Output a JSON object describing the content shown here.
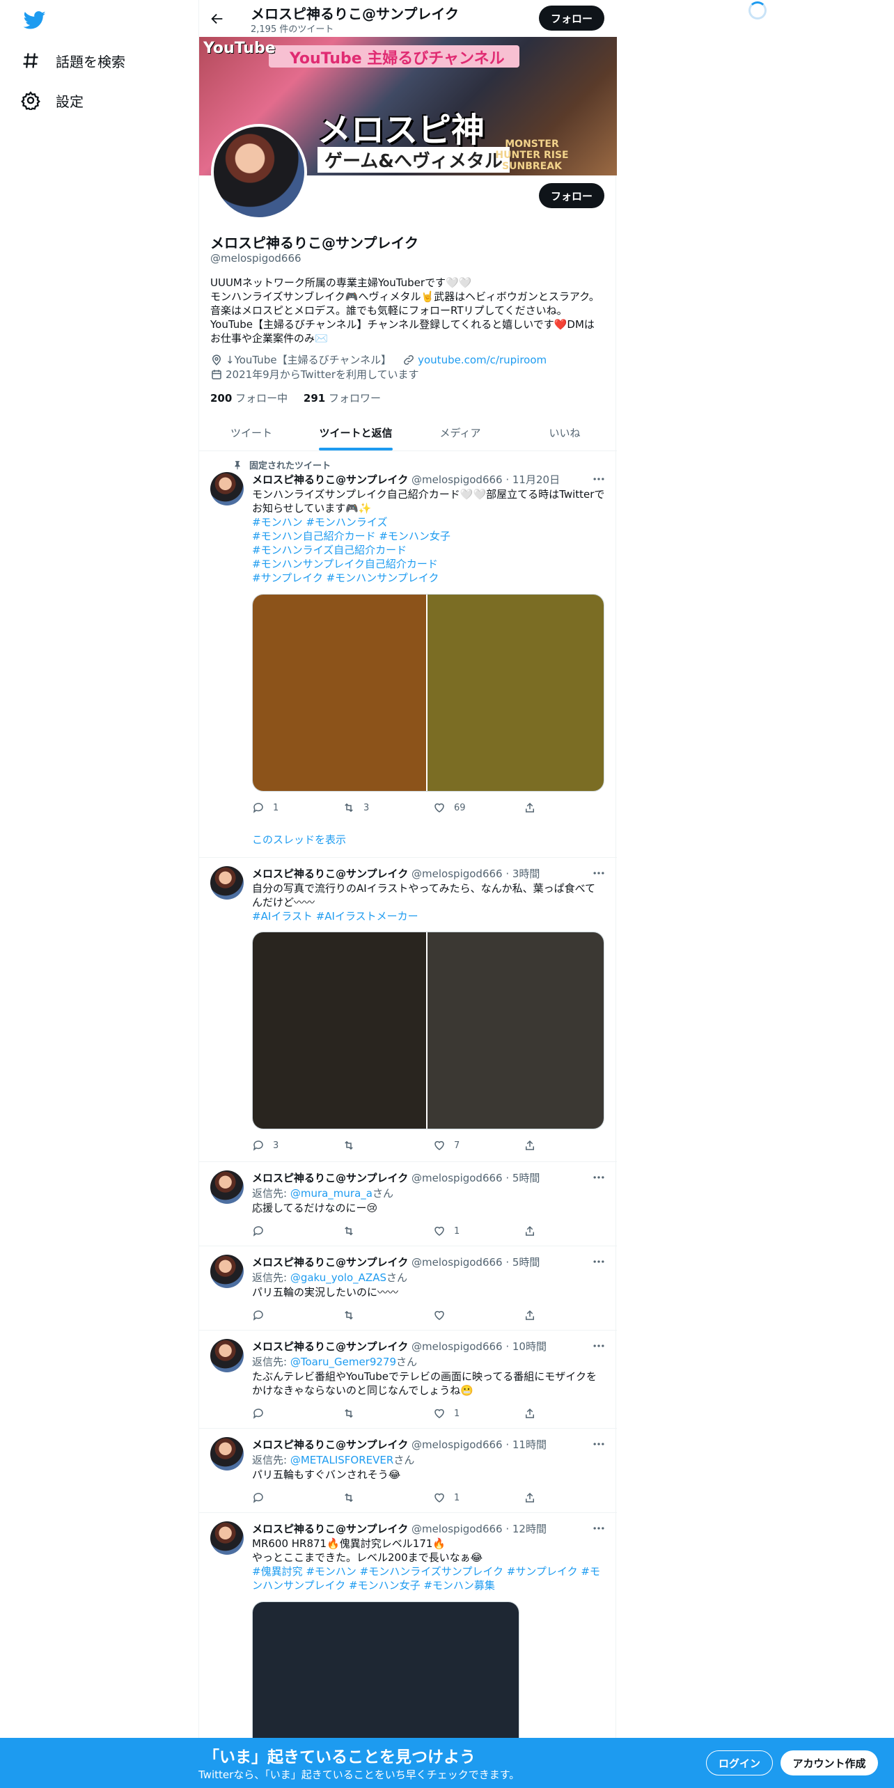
{
  "nav": {
    "explore_label": "話題を検索",
    "settings_label": "設定"
  },
  "topbar": {
    "name": "メロスピ神るりこ@サンプレイク",
    "tweet_count": "2,195 件のツイート",
    "follow_label": "フォロー"
  },
  "banner": {
    "channel_text": "YouTube 主婦るびチャンネル",
    "title_text": "メロスピ神",
    "subtitle_text": "ゲーム&へヴィメタル",
    "youtube_text": "YouTube",
    "game_text": "MONSTER HUNTER RISE SUNBREAK"
  },
  "profile": {
    "name": "メロスピ神るりこ@サンプレイク",
    "handle": "@melospigod666",
    "follow_label": "フォロー",
    "bio_lines": [
      "UUUMネットワーク所属の専業主婦YouTuberです🤍🤍",
      "モンハンライズサンブレイク🎮へヴィメタル🤘武器はヘビィボウガンとスラアク。",
      "音楽はメロスピとメロデス。誰でも気軽にフォローRTリプしてくださいね。",
      "YouTube【主婦るびチャンネル】チャンネル登録してくれると嬉しいです❤️DMは",
      "お仕事や企業案件のみ✉️"
    ],
    "location": "↓YouTube【主婦るびチャンネル】",
    "url": "youtube.com/c/rupiroom",
    "joined": "2021年9月からTwitterを利用しています",
    "following_count": "200",
    "following_label": "フォロー中",
    "followers_count": "291",
    "followers_label": "フォロワー"
  },
  "tabs": [
    "ツイート",
    "ツイートと返信",
    "メディア",
    "いいね"
  ],
  "pinned_label": "固定されたツイート",
  "thread_link": "このスレッドを表示",
  "tweets": [
    {
      "name": "メロスピ神るりこ@サンプレイク",
      "meta": "@melospigod666 · 11月20日",
      "text_lines": [
        "モンハンライズサンプレイク自己紹介カード🤍🤍部屋立てる時はTwitterで",
        "お知らせしています🎮✨"
      ],
      "hashtag_lines": [
        "#モンハン #モンハンライズ",
        "#モンハン自己紹介カード #モンハン女子",
        "#モンハンライズ自己紹介カード",
        "#モンハンサンプレイク自己紹介カード",
        "#サンプレイク #モンハンサンプレイク"
      ],
      "media_colors": [
        "#8c531a",
        "#7b6d24"
      ],
      "reply": "1",
      "retweet": "3",
      "like": "69"
    },
    {
      "name": "メロスピ神るりこ@サンプレイク",
      "meta": "@melospigod666 · 3時間",
      "text_lines": [
        "自分の写真で流行りのAIイラストやってみたら、なんか私、葉っぱ食べて",
        "んだけど〰〰"
      ],
      "hashtag_lines": [
        "#AIイラスト #AIイラストメーカー"
      ],
      "media_colors": [
        "#29251f",
        "#3b3833"
      ],
      "reply": "3",
      "retweet": "",
      "like": "7"
    },
    {
      "name": "メロスピ神るりこ@サンプレイク",
      "meta": "@melospigod666 · 5時間",
      "reply_prefix": "返信先: ",
      "reply_to": "@mura_mura_a",
      "reply_suffix": "さん",
      "text": "応援してるだけなのにー😢",
      "reply": "",
      "retweet": "",
      "like": "1"
    },
    {
      "name": "メロスピ神るりこ@サンプレイク",
      "meta": "@melospigod666 · 5時間",
      "reply_prefix": "返信先: ",
      "reply_to": "@gaku_yolo_AZAS",
      "reply_suffix": "さん",
      "text": "パリ五輪の実況したいのに〰〰",
      "reply": "",
      "retweet": "",
      "like": ""
    },
    {
      "name": "メロスピ神るりこ@サンプレイク",
      "meta": "@melospigod666 · 10時間",
      "reply_prefix": "返信先: ",
      "reply_to": "@Toaru_Gemer9279",
      "reply_suffix": "さん",
      "text_lines": [
        "たぶんテレビ番組やYouTubeでテレビの画面に映ってる番組にモザイクを",
        "かけなきゃならないのと同じなんでしょうね😬"
      ],
      "reply": "",
      "retweet": "",
      "like": "1"
    },
    {
      "name": "メロスピ神るりこ@サンプレイク",
      "meta": "@melospigod666 · 11時間",
      "reply_prefix": "返信先: ",
      "reply_to": "@METALISFOREVER",
      "reply_suffix": "さん",
      "text": "パリ五輪もすぐバンされそう😂",
      "reply": "",
      "retweet": "",
      "like": "1"
    },
    {
      "name": "メロスピ神るりこ@サンプレイク",
      "meta": "@melospigod666 · 12時間",
      "text_lines": [
        "MR600 HR871🔥傀異討究レベル171🔥",
        "やっとここまできた。レベル200まで長いなぁ😂"
      ],
      "hashtag_lines": [
        "#傀異討究 #モンハン #モンハンライズサンプレイク #サンプレイク #モ",
        "ンハンサンプレイク #モンハン女子 #モンハン募集"
      ],
      "media_colors": [
        "#1e2733"
      ]
    }
  ],
  "bottom": {
    "title": "「いま」起きていることを見つけよう",
    "subtitle": "Twitterなら、「いま」起きていることをいち早くチェックできます。",
    "login": "ログイン",
    "signup": "アカウント作成"
  }
}
